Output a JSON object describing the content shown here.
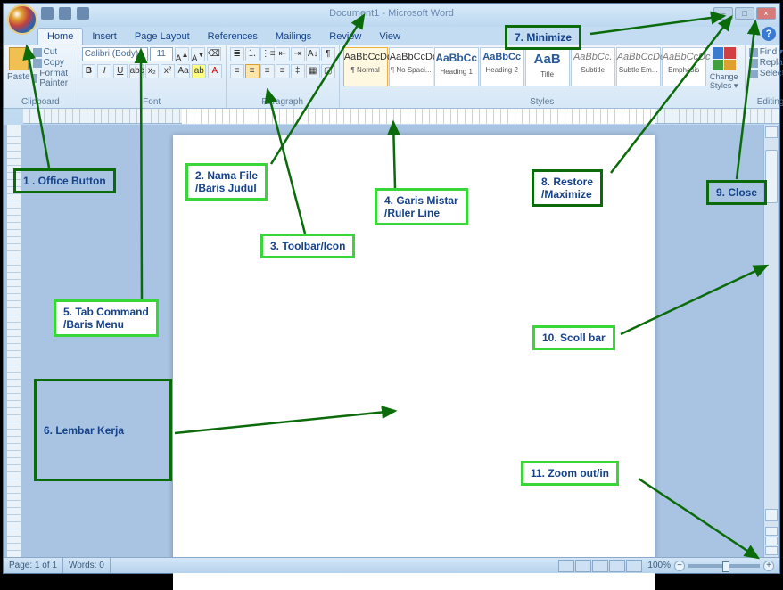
{
  "title": "Document1 - Microsoft Word",
  "tabs": [
    "Home",
    "Insert",
    "Page Layout",
    "References",
    "Mailings",
    "Review",
    "View"
  ],
  "active_tab": 0,
  "clipboard": {
    "paste": "Paste",
    "cut": "Cut",
    "copy": "Copy",
    "fmt": "Format Painter",
    "label": "Clipboard"
  },
  "font": {
    "name": "Calibri (Body)",
    "size": "11",
    "label": "Font"
  },
  "para": {
    "label": "Paragraph"
  },
  "styles": {
    "label": "Styles",
    "items": [
      {
        "sample": "AaBbCcDc",
        "name": "¶ Normal",
        "cls": ""
      },
      {
        "sample": "AaBbCcDc",
        "name": "¶ No Spaci...",
        "cls": ""
      },
      {
        "sample": "AaBbCc",
        "name": "Heading 1",
        "cls": "h1"
      },
      {
        "sample": "AaBbCc",
        "name": "Heading 2",
        "cls": "h2"
      },
      {
        "sample": "AaB",
        "name": "Title",
        "cls": "tt"
      },
      {
        "sample": "AaBbCc.",
        "name": "Subtitle",
        "cls": "sub"
      },
      {
        "sample": "AaBbCcDc",
        "name": "Subtle Em...",
        "cls": "sub"
      },
      {
        "sample": "AaBbCcDc",
        "name": "Emphasis",
        "cls": "sub"
      }
    ],
    "change": "Change Styles"
  },
  "editing": {
    "find": "Find",
    "replace": "Replace",
    "select": "Select",
    "label": "Editing"
  },
  "status": {
    "page": "Page: 1 of 1",
    "words": "Words: 0",
    "zoom": "100%"
  },
  "annotations": {
    "a1": "1 . Office Button",
    "a2": "2. Nama File\n/Baris Judul",
    "a3": "3. Toolbar/Icon",
    "a4": "4. Garis Mistar\n/Ruler Line",
    "a5": "5. Tab Command\n/Baris Menu",
    "a6": "6. Lembar Kerja",
    "a7": "7. Minimize",
    "a8": "8. Restore\n/Maximize",
    "a9": "9. Close",
    "a10": "10. Scoll bar",
    "a11": "11. Zoom out/in"
  }
}
